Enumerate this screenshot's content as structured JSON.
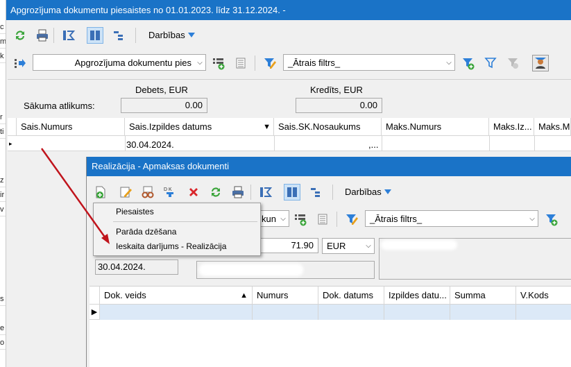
{
  "left_strip": {
    "chars": [
      "c",
      "m",
      "k",
      "",
      "",
      "",
      "",
      "",
      "",
      "r",
      "ti",
      "",
      "",
      "z",
      "ir",
      "v",
      "",
      "",
      "",
      "s",
      "",
      "e",
      "o",
      "",
      ""
    ]
  },
  "main_window": {
    "title": "Apgrozījuma dokumentu piesaistes no 01.01.2023. līdz 31.12.2024. -",
    "toolbar": {
      "darbibas_label": "Darbības"
    },
    "doc_combo_value": "Apgrozījuma dokumentu pies",
    "filter_combo_value": "_Ātrais filtrs_",
    "summary": {
      "debets_label": "Debets, EUR",
      "kredits_label": "Kredīts, EUR",
      "sakuma_label": "Sākuma atlikums:",
      "debets_value": "0.00",
      "kredits_value": "0.00"
    },
    "grid": {
      "columns": [
        "Sais.Numurs",
        "Sais.Izpildes datums",
        "Sais.SK.Nosaukums",
        "Maks.Numurs",
        "Maks.Iz...",
        "Maks.MK"
      ],
      "sort_indicator": "▼",
      "row": {
        "date": "30.04.2024.",
        "name_tail": ",..."
      }
    }
  },
  "sub_window": {
    "title": "Realizācija - Apmaksas dokumenti",
    "darbibas_label": "Darbības",
    "combo_partial": "kun",
    "filter_combo_value": "_Ātrais filtrs_",
    "amount": "71.90",
    "currency": "EUR",
    "date": "30.04.2024.",
    "grid": {
      "columns": [
        "Dok. veids",
        "Numurs",
        "Dok. datums",
        "Izpildes datu...",
        "Summa",
        "V.Kods"
      ],
      "sort_indicator": "▲"
    }
  },
  "popup_menu": {
    "items": [
      "Piesaistes",
      "Parāda dzēšana",
      "Ieskaita darījums - Realizācija"
    ]
  },
  "colors": {
    "titlebar": "#1a73c7",
    "arrow": "#c0141c",
    "selected_row": "#dce9f7"
  }
}
